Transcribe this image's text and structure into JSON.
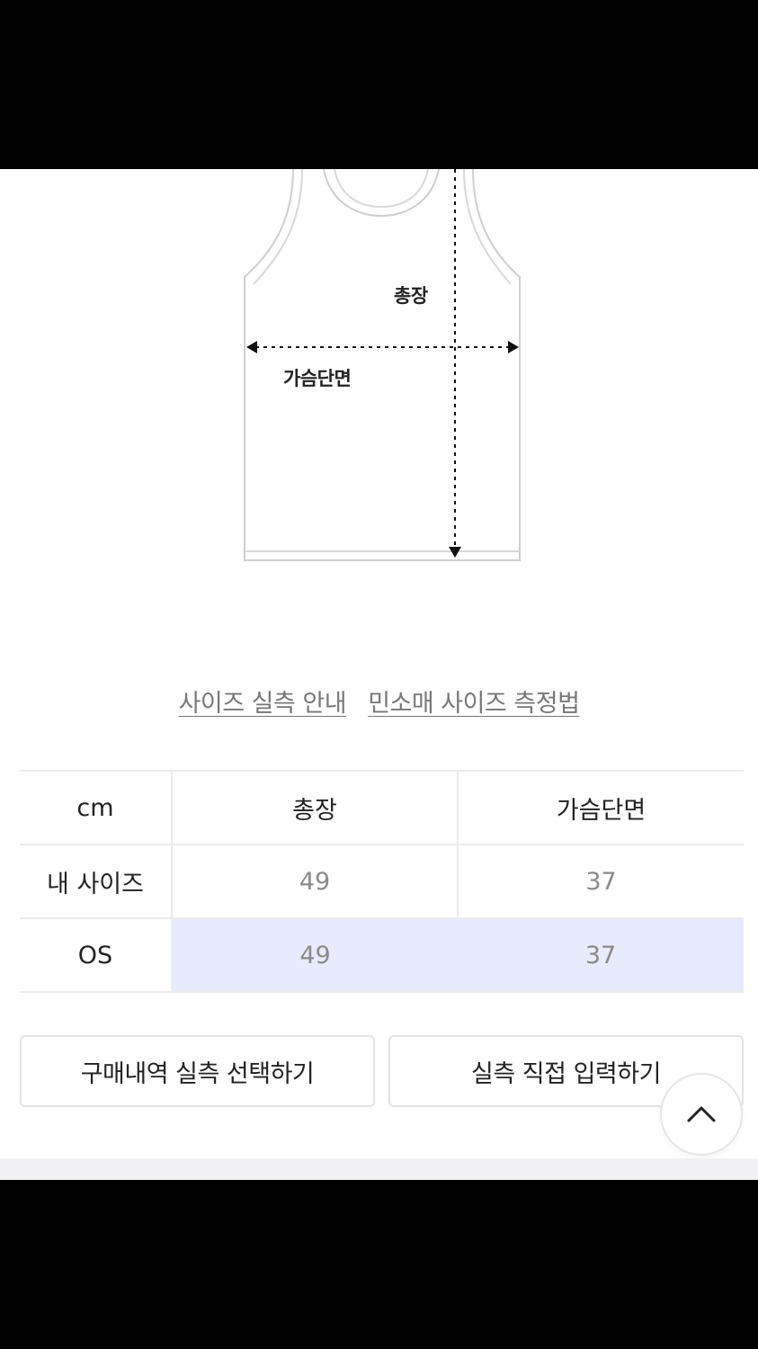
{
  "diagram": {
    "length_label": "총장",
    "chest_label": "가슴단면"
  },
  "links": {
    "size_guide": "사이즈 실측 안내",
    "measure_method": "민소매 사이즈 측정법"
  },
  "table": {
    "headers": [
      "cm",
      "총장",
      "가슴단면"
    ],
    "rows": [
      {
        "label": "내 사이즈",
        "length": "49",
        "chest": "37"
      },
      {
        "label": "OS",
        "length": "49",
        "chest": "37"
      }
    ]
  },
  "buttons": {
    "select_history": "구매내역 실측 선택하기",
    "direct_input": "실측 직접 입력하기"
  },
  "icons": {
    "scroll_top": "chevron-up-icon"
  },
  "colors": {
    "highlight_row": "#e8ebfc",
    "border": "#ececec"
  }
}
